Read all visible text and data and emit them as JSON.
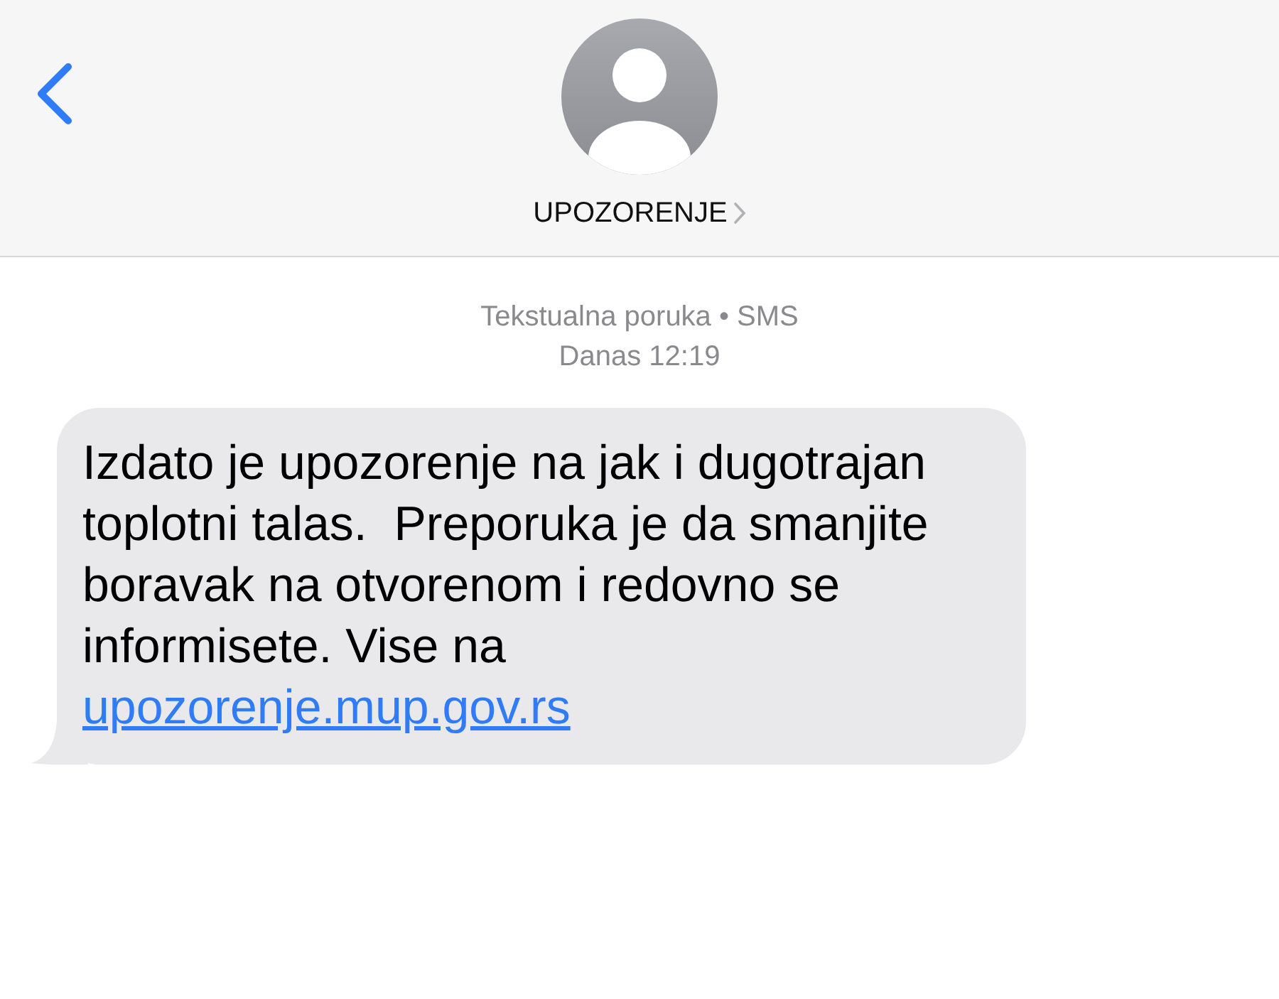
{
  "header": {
    "contact_name": "UPOZORENJE"
  },
  "message_meta": {
    "service": "Tekstualna poruka • SMS",
    "time": "Danas 12:19"
  },
  "messages": [
    {
      "text": "Izdato je upozorenje na jak i dugotrajan toplotni talas.  Preporuka je da smanjite boravak na otvorenom i redovno se informisete. Vise na",
      "link": "upozorenje.mup.gov.rs"
    }
  ]
}
